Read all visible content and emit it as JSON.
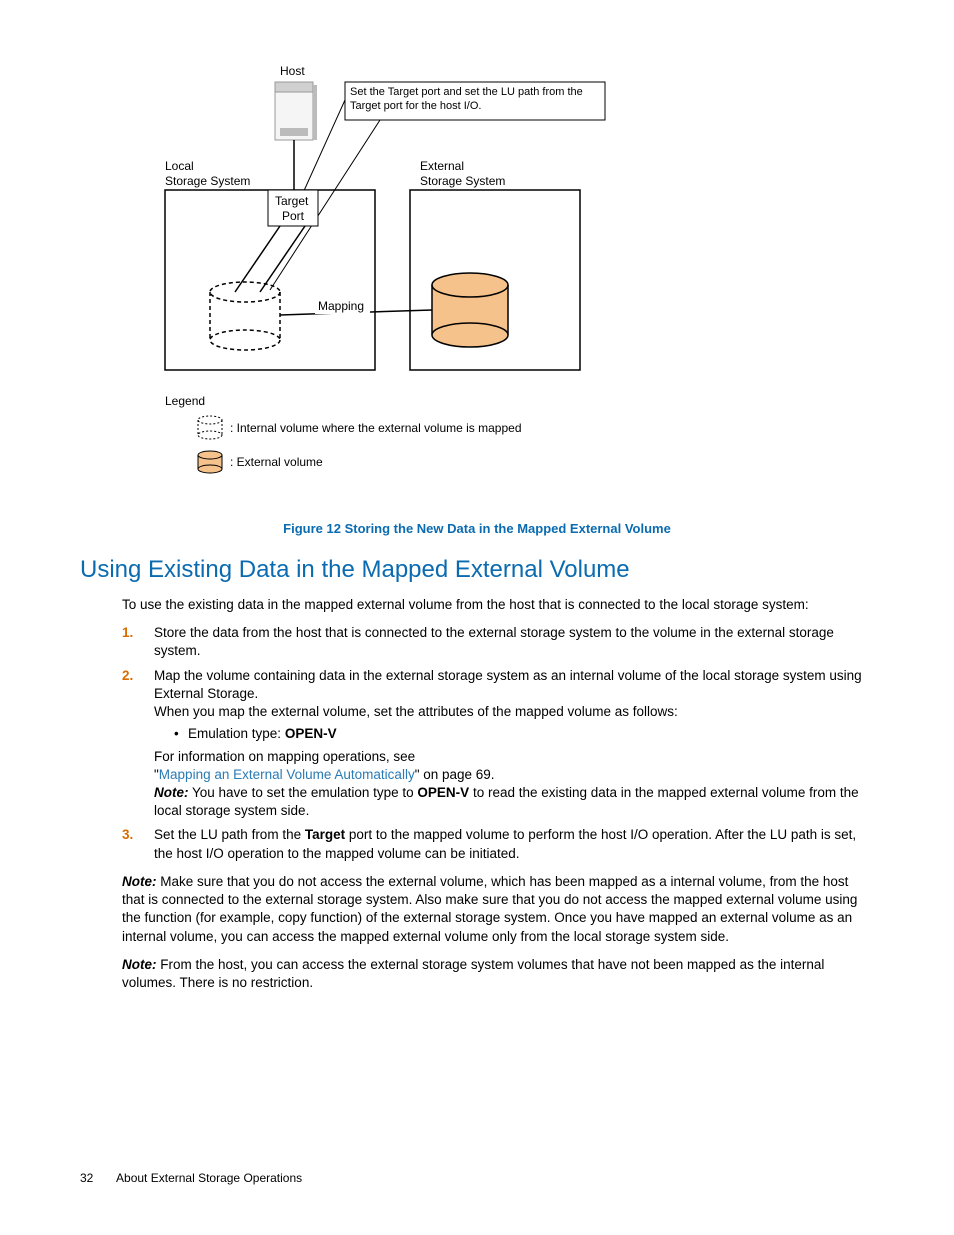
{
  "diagram": {
    "host_label": "Host",
    "callout": "Set the Target port and set the LU path from the Target port for the host I/O.",
    "local_label1": "Local",
    "local_label2": "Storage System",
    "external_label1": "External",
    "external_label2": "Storage System",
    "target_label1": "Target",
    "target_label2": "Port",
    "mapping_label": "Mapping",
    "legend_title": "Legend",
    "legend_internal": ": Internal volume where the external volume is mapped",
    "legend_external": ": External volume"
  },
  "figure_caption": "Figure 12 Storing the New Data in the Mapped External Volume",
  "heading": "Using Existing Data in the Mapped External Volume",
  "intro": "To use the existing data in the mapped external volume from the host that is connected to the local storage system:",
  "steps": {
    "s1": "Store the data from the host that is connected to the external storage system to the volume in the external storage system.",
    "s2a": "Map the volume containing data in the external storage system as an internal volume of the local storage system using External Storage.",
    "s2b": "When you map the external volume, set the attributes of the mapped volume as follows:",
    "s2_bullet_pre": "Emulation type: ",
    "s2_bullet_bold": "OPEN-V",
    "s2c": "For information on mapping operations, see",
    "s2_link_pre": "\"",
    "s2_link": "Mapping an External Volume Automatically",
    "s2_link_post": "\" on page 69.",
    "s2_note_label": "Note:",
    "s2_note_a": " You have to set the emulation type to ",
    "s2_note_bold": "OPEN-V",
    "s2_note_b": " to read the existing data in the mapped external volume from the local storage system side.",
    "s3a": "Set the LU path from the ",
    "s3_bold": "Target",
    "s3b": " port to the mapped volume to perform the host I/O operation. After the LU path is set, the host I/O operation to the mapped volume can be initiated."
  },
  "note1_label": "Note:",
  "note1": " Make sure that you do not access the external volume, which has been mapped as a internal volume, from the host that is connected to the external storage system. Also make sure that you do not access the mapped external volume using the function (for example, copy function) of the external storage system. Once you have mapped an external volume as an internal volume, you can access the mapped external volume only from the local storage system side.",
  "note2_label": "Note:",
  "note2": " From the host, you can access the external storage system volumes that have not been mapped as the internal volumes. There is no restriction.",
  "footer": {
    "page": "32",
    "title": "About External Storage Operations"
  }
}
